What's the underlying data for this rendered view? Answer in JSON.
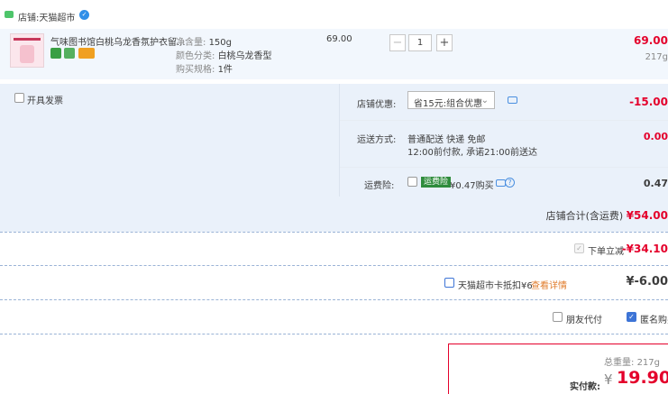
{
  "shop": {
    "label": "店铺:",
    "name": "天猫超市"
  },
  "item": {
    "title": "气味图书馆白桃乌龙香氛护衣留...",
    "net_label": "净含量:",
    "net_value": "150g",
    "color_label": "颜色分类:",
    "color_value": "白桃乌龙香型",
    "spec_label": "购买规格:",
    "spec_value": "1件",
    "unit_price": "69.00",
    "quantity": "1",
    "minus": "−",
    "plus": "+",
    "subtotal": "69.00",
    "weight": "217g"
  },
  "invoice": {
    "label": "开具发票"
  },
  "discount": {
    "label": "店铺优惠:",
    "selected": "省15元:组合优惠",
    "amount": "-15.00"
  },
  "shipping": {
    "label": "运送方式:",
    "line1": "普通配送 快递 免邮",
    "line2": "12:00前付款, 承诺21:00前送达",
    "amount": "0.00"
  },
  "insurance": {
    "label": "运费险:",
    "tag": "运费险",
    "price": "¥0.47购买",
    "amount": "0.47"
  },
  "shop_total": {
    "label": "店铺合计(含运费)",
    "amount": "¥54.00"
  },
  "instant": {
    "label": "下单立减",
    "amount": "-¥34.10"
  },
  "card": {
    "label": "天猫超市卡抵扣¥6",
    "link": "查看详情",
    "amount": "¥-6.00"
  },
  "friend_pay": {
    "label": "朋友代付"
  },
  "anonymous": {
    "label": "匿名购买"
  },
  "summary": {
    "weight_label": "总重量:",
    "weight": "217g",
    "pay_label": "实付款:",
    "currency": "¥",
    "pay": "19.90"
  }
}
